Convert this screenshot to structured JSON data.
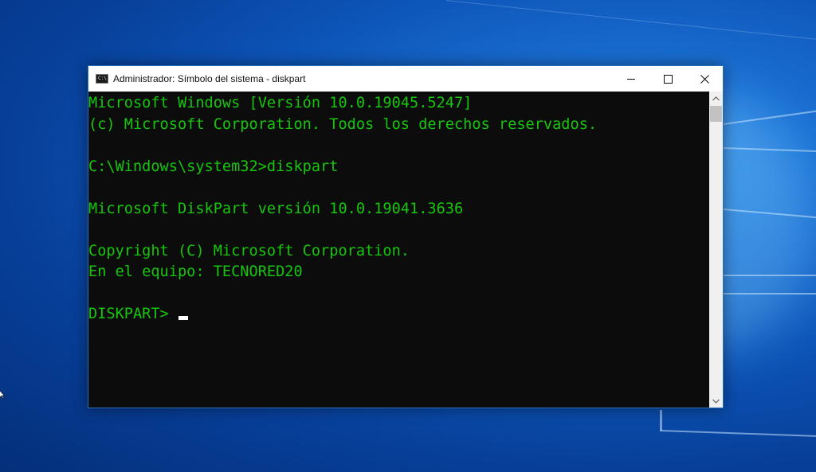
{
  "window": {
    "title": "Administrador: Símbolo del sistema - diskpart",
    "icon": "cmd-icon",
    "controls": [
      "minimize-icon",
      "maximize-icon",
      "close-icon"
    ]
  },
  "console": {
    "lines": [
      "Microsoft Windows [Versión 10.0.19045.5247]",
      "(c) Microsoft Corporation. Todos los derechos reservados.",
      "",
      "C:\\Windows\\system32>diskpart",
      "",
      "Microsoft DiskPart versión 10.0.19041.3636",
      "",
      "Copyright (C) Microsoft Corporation.",
      "En el equipo: TECNORED20",
      ""
    ],
    "prompt": "DISKPART> ",
    "text_color": "#16c60c",
    "background": "#0c0c0c"
  }
}
